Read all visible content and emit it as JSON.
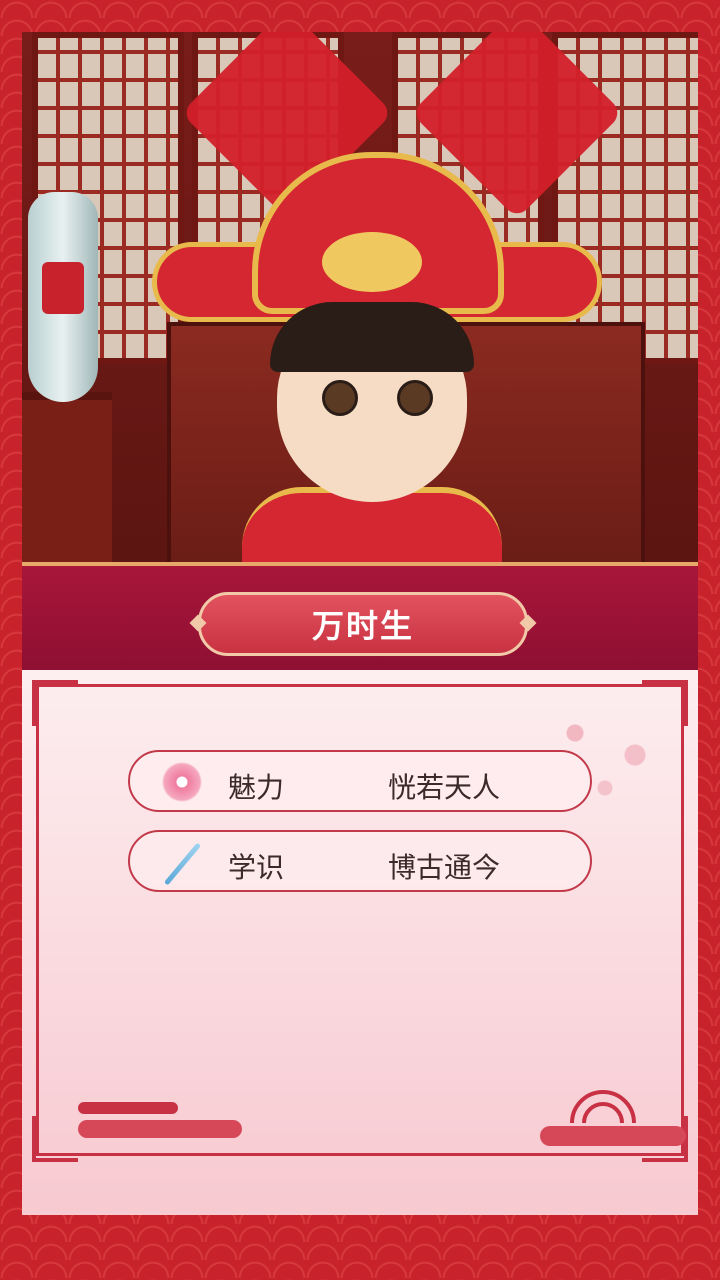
{
  "character": {
    "name": "万时生"
  },
  "attributes": [
    {
      "icon": "plum-blossom-icon",
      "label": "魅力",
      "value": "恍若天人"
    },
    {
      "icon": "brush-icon",
      "label": "学识",
      "value": "博古通今"
    }
  ],
  "colors": {
    "border_red": "#c8232c",
    "name_band": "#a8163a",
    "name_plate": "#d84050",
    "panel_pink": "#fbe0e4",
    "frame_red": "#c83043"
  }
}
